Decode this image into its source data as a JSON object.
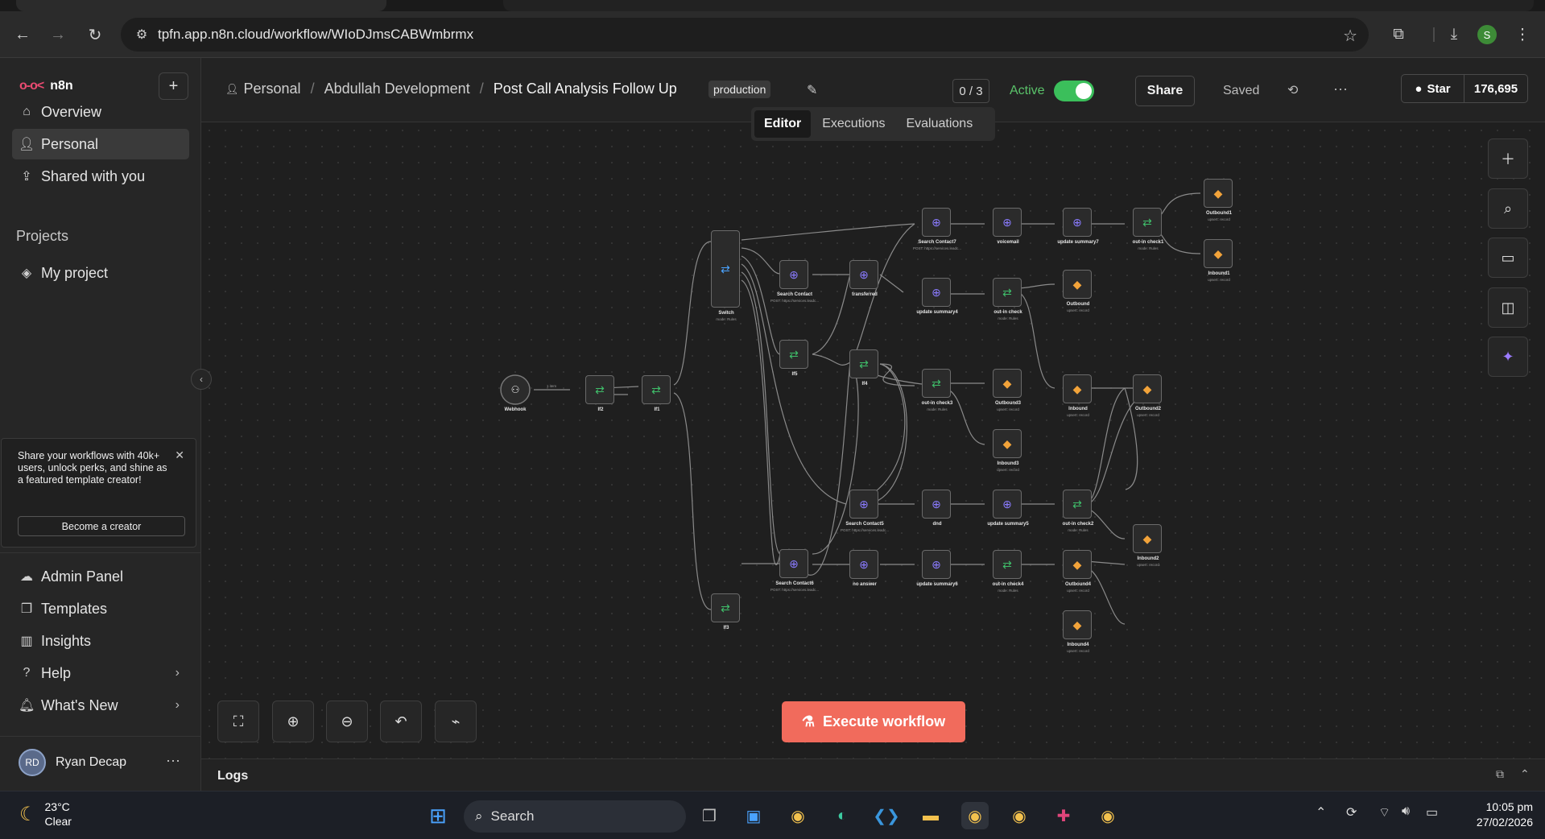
{
  "browser": {
    "url": "tpfn.app.n8n.cloud/workflow/WIoDJmsCABWmbrmx",
    "profile_initial": "S"
  },
  "sidebar": {
    "brand": "n8n",
    "items": [
      {
        "label": "Overview",
        "icon": "home-icon"
      },
      {
        "label": "Personal",
        "icon": "user-icon",
        "active": true
      },
      {
        "label": "Shared with you",
        "icon": "share-icon"
      }
    ],
    "projects_label": "Projects",
    "projects": [
      {
        "label": "My project",
        "icon": "layers-icon"
      }
    ],
    "promo": {
      "text": "Share your workflows with 40k+ users, unlock perks, and shine as a featured template creator!",
      "button": "Become a creator"
    },
    "bottom_items": [
      {
        "label": "Admin Panel",
        "icon": "cloud-icon"
      },
      {
        "label": "Templates",
        "icon": "templates-icon"
      },
      {
        "label": "Insights",
        "icon": "insights-icon"
      },
      {
        "label": "Help",
        "icon": "help-icon"
      },
      {
        "label": "What's New",
        "icon": "bell-icon"
      }
    ],
    "user": {
      "initials": "RD",
      "name": "Ryan Decap"
    }
  },
  "header": {
    "breadcrumb": [
      "Personal",
      "Abdullah Development"
    ],
    "workflow_name": "Post Call Analysis Follow Up",
    "tag": "production",
    "counter": "0 / 3",
    "active_label": "Active",
    "share_label": "Share",
    "saved_label": "Saved",
    "github": {
      "star_label": "Star",
      "count": "176,695"
    }
  },
  "tabs": [
    "Editor",
    "Executions",
    "Evaluations"
  ],
  "canvas": {
    "execute_label": "Execute workflow",
    "nodes": [
      {
        "name": "Webhook",
        "sub": ""
      },
      {
        "name": "If2",
        "sub": ""
      },
      {
        "name": "If1",
        "sub": ""
      },
      {
        "name": "Switch",
        "sub": "mode: Rules"
      },
      {
        "name": "Search Contact",
        "sub": "POST: https://services.leadc..."
      },
      {
        "name": "transferred",
        "sub": ""
      },
      {
        "name": "If5",
        "sub": ""
      },
      {
        "name": "If4",
        "sub": ""
      },
      {
        "name": "If3",
        "sub": ""
      },
      {
        "name": "Search Contact7",
        "sub": "POST: https://services.leadc..."
      },
      {
        "name": "voicemail",
        "sub": ""
      },
      {
        "name": "update summary7",
        "sub": ""
      },
      {
        "name": "out-in check1",
        "sub": "mode: Rules"
      },
      {
        "name": "Outbound1",
        "sub": "upsert: record"
      },
      {
        "name": "Inbound1",
        "sub": "upsert: record"
      },
      {
        "name": "update summary4",
        "sub": ""
      },
      {
        "name": "out-in check",
        "sub": "mode: Rules"
      },
      {
        "name": "Outbound",
        "sub": "upsert: record"
      },
      {
        "name": "out-in check3",
        "sub": "mode: Rules"
      },
      {
        "name": "Outbound3",
        "sub": "upsert: record"
      },
      {
        "name": "Inbound3",
        "sub": "upsert: record"
      },
      {
        "name": "Inbound",
        "sub": "upsert: record"
      },
      {
        "name": "Outbound2",
        "sub": "upsert: record"
      },
      {
        "name": "Search Contact5",
        "sub": "POST: https://services.leadc..."
      },
      {
        "name": "dnd",
        "sub": ""
      },
      {
        "name": "update summary5",
        "sub": ""
      },
      {
        "name": "out-in check2",
        "sub": "mode: Rules"
      },
      {
        "name": "Inbound2",
        "sub": "upsert: record"
      },
      {
        "name": "Search Contact6",
        "sub": "POST: https://services.leadc..."
      },
      {
        "name": "no answer",
        "sub": ""
      },
      {
        "name": "update summary6",
        "sub": ""
      },
      {
        "name": "out-in check4",
        "sub": "mode: Rules"
      },
      {
        "name": "Outbound4",
        "sub": "upsert: record"
      },
      {
        "name": "Inbound4",
        "sub": "upsert: record"
      }
    ],
    "edge_label": "1 item"
  },
  "logs_label": "Logs",
  "taskbar": {
    "temp": "23°C",
    "condition": "Clear",
    "search_label": "Search",
    "time": "10:05 pm",
    "date": "27/02/2026"
  }
}
